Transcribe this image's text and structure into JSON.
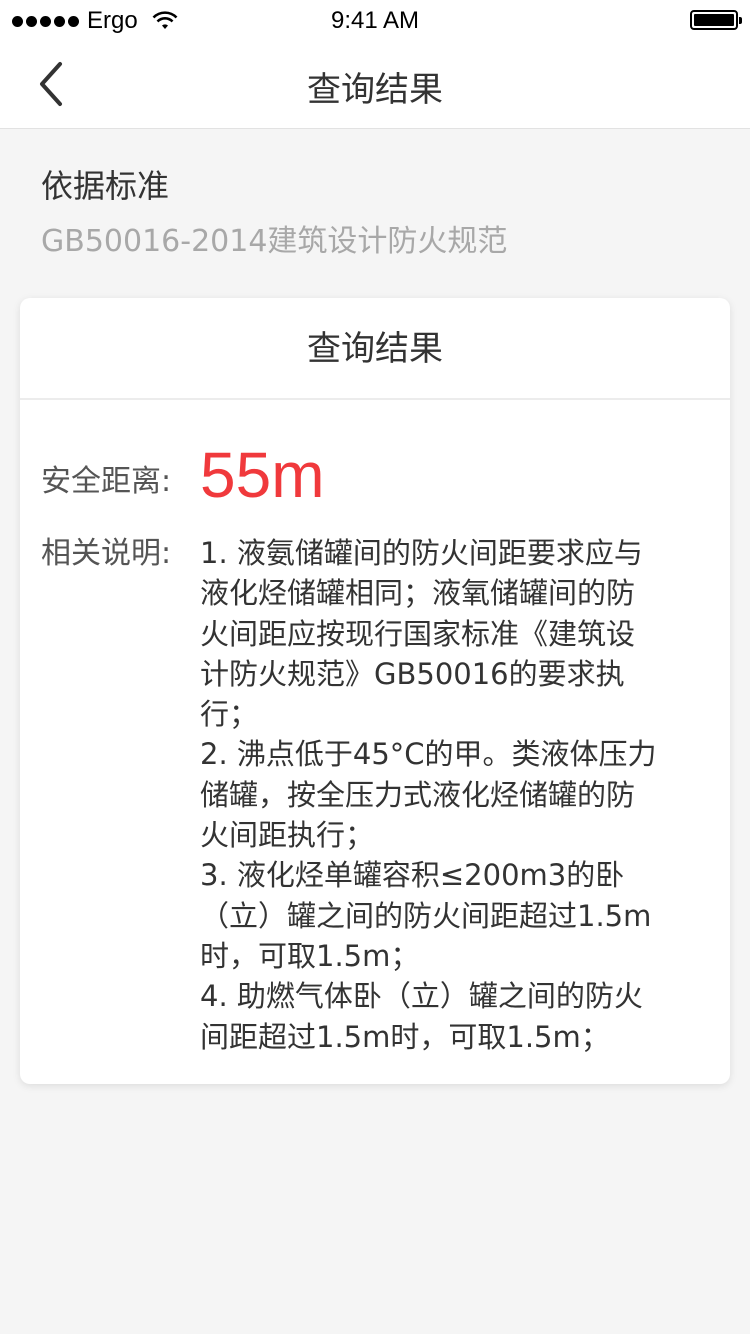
{
  "status_bar": {
    "carrier": "Ergo",
    "time": "9:41 AM",
    "battery_level": 1.0
  },
  "nav": {
    "title": "查询结果"
  },
  "basis": {
    "label": "依据标准",
    "value": "GB50016-2014建筑设计防火规范"
  },
  "result_card": {
    "header": "查询结果",
    "distance_label": "安全距离:",
    "distance_value": "55m",
    "distance_color": "#f0393c",
    "description_label": "相关说明:",
    "description_lines": [
      "1. 液氨储罐间的防火间距要求应与",
      "液化烃储罐相同；液氧储罐间的防",
      "火间距应按现行国家标准《建筑设",
      "计防火规范》GB50016的要求执",
      "行；",
      "2. 沸点低于45°C的甲。类液体压力",
      "储罐，按全压力式液化烃储罐的防",
      "火间距执行；",
      "3. 液化烃单罐容积≤200m3的卧",
      "（立）罐之间的防火间距超过1.5m",
      "时，可取1.5m；",
      "4. 助燃气体卧（立）罐之间的防火",
      "间距超过1.5m时，可取1.5m；"
    ]
  }
}
